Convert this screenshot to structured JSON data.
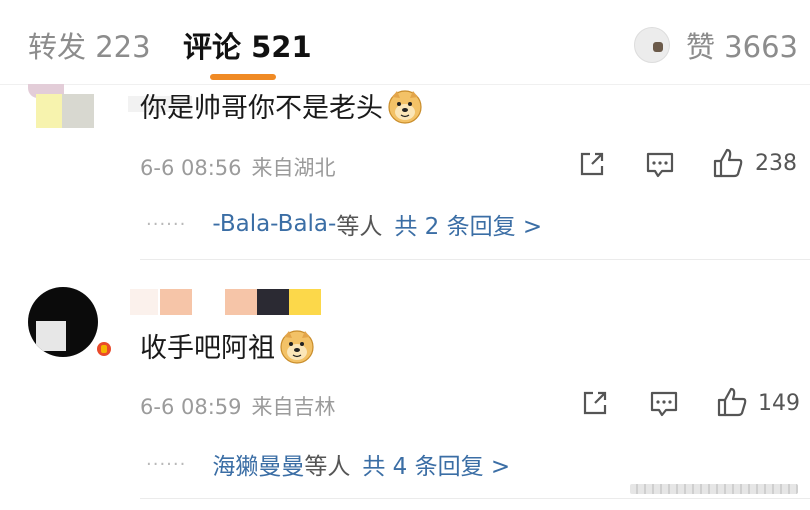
{
  "header": {
    "repost_label": "转发 223",
    "comments_label": "评论 521",
    "likes_label": "赞 3663",
    "accent_color": "#f08a24"
  },
  "comments": [
    {
      "text": "你是帅哥你不是老头",
      "emoji": "doge-emoji",
      "date": "6-6 08:56",
      "location": "来自湖北",
      "like_count": "238",
      "reply_names": "-Bala-Bala-",
      "reply_mid": "等人",
      "reply_total": "共 2 条回复 >",
      "dots": "······"
    },
    {
      "text": "收手吧阿祖",
      "emoji": "doge-emoji",
      "date": "6-6 08:59",
      "location": "来自吉林",
      "like_count": "149",
      "reply_names": "海獭曼曼",
      "reply_mid": "等人",
      "reply_total": "共 4 条回复 >",
      "dots": "······"
    }
  ],
  "icons": {
    "share": "share-icon",
    "comment": "comment-icon",
    "like": "thumbs-up-icon"
  }
}
